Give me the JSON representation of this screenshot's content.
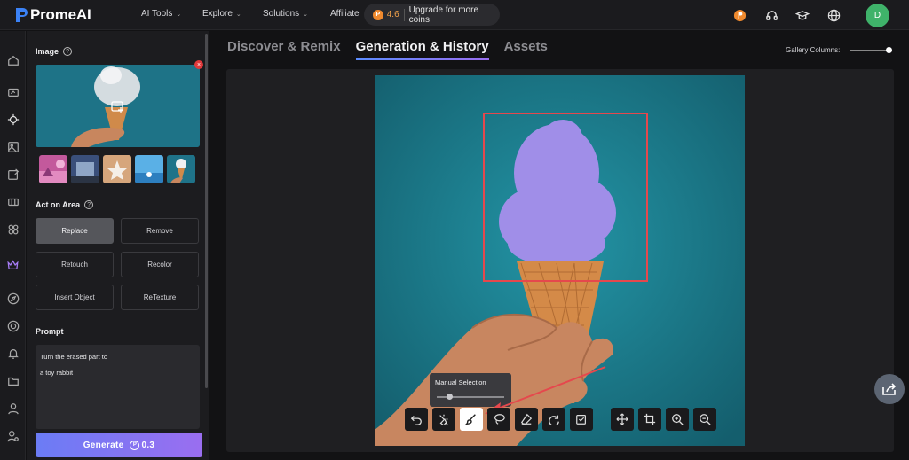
{
  "app": {
    "name": "PromeAI"
  },
  "nav": {
    "items": [
      {
        "label": "AI Tools",
        "has_dropdown": true
      },
      {
        "label": "Explore",
        "has_dropdown": true
      },
      {
        "label": "Solutions",
        "has_dropdown": true
      },
      {
        "label": "Affiliate",
        "has_dropdown": false
      }
    ],
    "coins": {
      "value": "4.6",
      "upgrade_label": "Upgrade for more coins"
    }
  },
  "user": {
    "avatar_initial": "D"
  },
  "panel": {
    "image_title": "Image",
    "act_title": "Act on Area",
    "actions": [
      {
        "label": "Replace",
        "active": true
      },
      {
        "label": "Remove",
        "active": false
      },
      {
        "label": "Retouch",
        "active": false
      },
      {
        "label": "Recolor",
        "active": false
      },
      {
        "label": "Insert Object",
        "active": false
      },
      {
        "label": "ReTexture",
        "active": false
      }
    ],
    "prompt_title": "Prompt",
    "prompt_lines": [
      "Turn the erased part to",
      "a toy rabbit"
    ],
    "generate_label": "Generate",
    "generate_cost": "0.3"
  },
  "tabs": [
    {
      "label": "Discover & Remix",
      "active": false
    },
    {
      "label": "Generation & History",
      "active": true
    },
    {
      "label": "Assets",
      "active": false
    }
  ],
  "gallery": {
    "columns_label": "Gallery Columns:"
  },
  "editor": {
    "tooltip_label": "Manual Selection",
    "tools": [
      "undo-icon",
      "auto-select-icon",
      "brush-icon",
      "lasso-icon",
      "eraser-icon",
      "redo-icon",
      "confirm-icon",
      "move-icon",
      "crop-icon",
      "zoom-in-icon",
      "zoom-out-icon"
    ],
    "active_tool": "brush-icon"
  },
  "colors": {
    "accent": "#9a6ef0",
    "selection": "#e5484d",
    "coin": "#f08a2e",
    "avatar": "#3fb26a"
  }
}
